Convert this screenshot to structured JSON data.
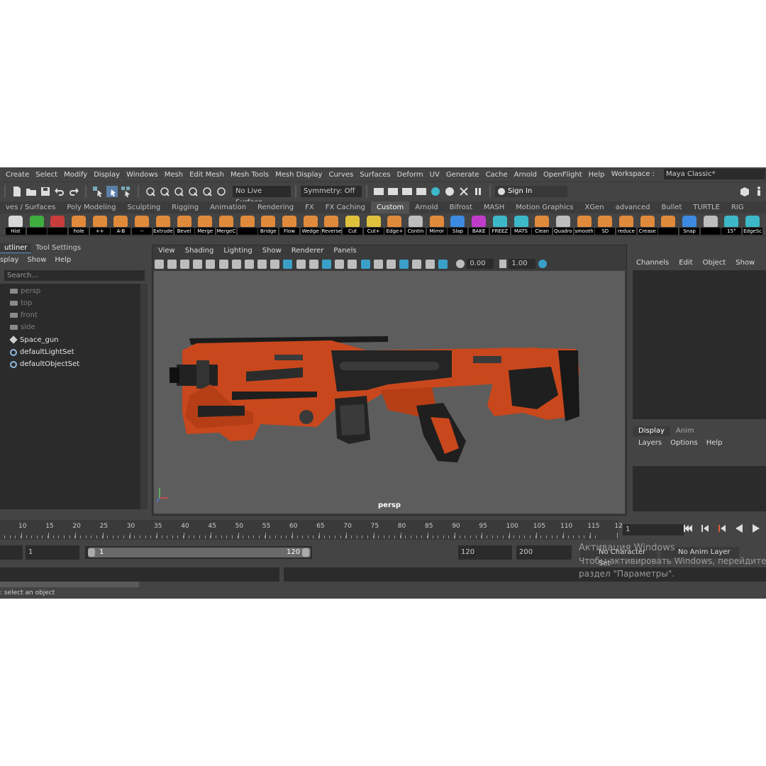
{
  "menubar": {
    "items": [
      "Create",
      "Select",
      "Modify",
      "Display",
      "Windows",
      "Mesh",
      "Edit Mesh",
      "Mesh Tools",
      "Mesh Display",
      "Curves",
      "Surfaces",
      "Deform",
      "UV",
      "Generate",
      "Cache",
      "Arnold",
      "OpenFlight",
      "Help"
    ],
    "workspace_label": "Workspace :",
    "workspace_value": "Maya Classic*"
  },
  "statusline": {
    "live_surface": "No Live Surface",
    "symmetry": "Symmetry: Off",
    "sign_in": "Sign In"
  },
  "shelf_tabs": {
    "items": [
      "ves / Surfaces",
      "Poly Modeling",
      "Sculpting",
      "Rigging",
      "Animation",
      "Rendering",
      "FX",
      "FX Caching",
      "Custom",
      "Arnold",
      "Bifrost",
      "MASH",
      "Motion Graphics",
      "XGen",
      "advanced",
      "Bullet",
      "TURTLE",
      "RIG"
    ],
    "active": "Custom"
  },
  "shelf": {
    "buttons": [
      {
        "label": "Hist",
        "color": "#d8d8d8"
      },
      {
        "label": "",
        "color": "#3fae3f"
      },
      {
        "label": "",
        "color": "#c83c3c"
      },
      {
        "label": "hole",
        "color": "#e08a3c"
      },
      {
        "label": "++",
        "color": "#e08a3c"
      },
      {
        "label": "A-B",
        "color": "#e08a3c"
      },
      {
        "label": "--",
        "color": "#e08a3c"
      },
      {
        "label": "Extrude",
        "color": "#e08a3c"
      },
      {
        "label": "Bevel",
        "color": "#e08a3c"
      },
      {
        "label": "Merge",
        "color": "#e08a3c"
      },
      {
        "label": "MergeC",
        "color": "#e08a3c"
      },
      {
        "label": "",
        "color": "#e08a3c"
      },
      {
        "label": "Bridge",
        "color": "#e08a3c"
      },
      {
        "label": "Flow",
        "color": "#e08a3c"
      },
      {
        "label": "Wedge",
        "color": "#e08a3c"
      },
      {
        "label": "Reverse",
        "color": "#e08a3c"
      },
      {
        "label": "Cut",
        "color": "#e0c13c"
      },
      {
        "label": "Cut+",
        "color": "#e0c13c"
      },
      {
        "label": "Edge+",
        "color": "#e08a3c"
      },
      {
        "label": "Contin",
        "color": "#bdbdbd"
      },
      {
        "label": "Mirror",
        "color": "#e08a3c"
      },
      {
        "label": "Slap",
        "color": "#3c8ae0"
      },
      {
        "label": "BAKE",
        "color": "#c03cc8"
      },
      {
        "label": "FREEZ",
        "color": "#3cb8c8"
      },
      {
        "label": "MATS",
        "color": "#3cb8c8"
      },
      {
        "label": "Clean",
        "color": "#e08a3c"
      },
      {
        "label": "Quadro",
        "color": "#bdbdbd"
      },
      {
        "label": "smooth",
        "color": "#e08a3c"
      },
      {
        "label": "SD",
        "color": "#e08a3c"
      },
      {
        "label": "reduce",
        "color": "#e08a3c"
      },
      {
        "label": "Crease",
        "color": "#e08a3c"
      },
      {
        "label": "",
        "color": "#e08a3c"
      },
      {
        "label": "Snap",
        "color": "#3c8ae0"
      },
      {
        "label": "",
        "color": "#bdbdbd"
      },
      {
        "label": "15°",
        "color": "#3cb8c8"
      },
      {
        "label": "EdgeSc",
        "color": "#3cb8c8"
      }
    ]
  },
  "outliner": {
    "tabs": [
      "utliner",
      "Tool Settings"
    ],
    "menu": [
      "splay",
      "Show",
      "Help"
    ],
    "search_placeholder": "Search...",
    "items": [
      {
        "label": "persp",
        "icon": "camera-icon",
        "dim": true
      },
      {
        "label": "top",
        "icon": "camera-icon",
        "dim": true
      },
      {
        "label": "front",
        "icon": "camera-icon",
        "dim": true
      },
      {
        "label": "side",
        "icon": "camera-icon",
        "dim": true
      },
      {
        "label": "Space_gun",
        "icon": "mesh-icon",
        "dim": false
      },
      {
        "label": "defaultLightSet",
        "icon": "set-icon",
        "dim": false
      },
      {
        "label": "defaultObjectSet",
        "icon": "set-icon",
        "dim": false
      }
    ]
  },
  "viewport": {
    "menu": [
      "View",
      "Shading",
      "Lighting",
      "Show",
      "Renderer",
      "Panels"
    ],
    "value_a": "0.00",
    "value_b": "1.00",
    "camera": "persp"
  },
  "channelbox": {
    "menu": [
      "Channels",
      "Edit",
      "Object",
      "Show"
    ],
    "layer_tabs": [
      "Display",
      "Anim"
    ],
    "layer_menu": [
      "Layers",
      "Options",
      "Help"
    ]
  },
  "timeline": {
    "ticks": [
      "10",
      "15",
      "20",
      "25",
      "30",
      "35",
      "40",
      "45",
      "50",
      "55",
      "60",
      "65",
      "70",
      "75",
      "80",
      "85",
      "90",
      "95",
      "100",
      "105",
      "110",
      "115",
      "12"
    ],
    "current_frame": "1"
  },
  "range": {
    "start": "1",
    "slider_start": "1",
    "slider_end": "120",
    "end": "120",
    "max": "200",
    "character_set": "No Character Set",
    "anim_layer": "No Anim Layer"
  },
  "helpline": ": select an object",
  "watermark": {
    "line1": "Активация Windows",
    "line2": "Чтобы активировать Windows, перейдите в",
    "line3": "раздел \"Параметры\"."
  }
}
